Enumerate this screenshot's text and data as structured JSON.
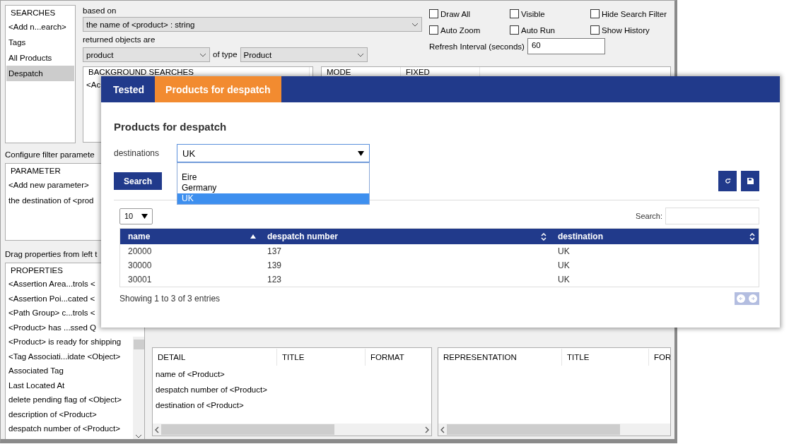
{
  "back_window": {
    "searches": {
      "header": "SEARCHES",
      "items": [
        {
          "label": "<Add n...earch>",
          "selected": false
        },
        {
          "label": "Tags",
          "selected": false
        },
        {
          "label": "All Products",
          "selected": false
        },
        {
          "label": "Despatch",
          "selected": true
        }
      ]
    },
    "based_on": {
      "label": "based on",
      "value": "the name of <product> : string"
    },
    "returned": {
      "label": "returned objects are",
      "value": "product",
      "type_label": "of type",
      "type_value": "Product"
    },
    "checkboxes": [
      {
        "label": "Draw All",
        "checked": false
      },
      {
        "label": "Visible",
        "checked": false
      },
      {
        "label": "Hide Search Filter",
        "checked": false
      },
      {
        "label": "Auto Zoom",
        "checked": false
      },
      {
        "label": "Auto Run",
        "checked": false
      },
      {
        "label": "Show History",
        "checked": false
      }
    ],
    "refresh": {
      "label": "Refresh Interval (seconds)",
      "value": "60"
    },
    "background_searches": {
      "header": "BACKGROUND SEARCHES",
      "items": [
        "<Ac"
      ]
    },
    "mode_panel": {
      "columns": [
        "MODE",
        "FIXED"
      ]
    },
    "parameters": {
      "caption": "Configure filter paramete",
      "header": "PARAMETER",
      "items": [
        "<Add new parameter>",
        "the destination of <prod"
      ]
    },
    "properties": {
      "caption": "Drag properties from left t",
      "header": "PROPERTIES",
      "items": [
        "<Assertion Area...trols <",
        "<Assertion Poi...cated <",
        "<Path Group> c...trols <",
        "<Product> has ...ssed Q",
        "<Product> is ready for shipping",
        "<Tag Associati...idate <Object>",
        "Associated Tag",
        "Last Located At",
        "delete pending flag of <Object>",
        "description of <Product>",
        "despatch number of <Product>"
      ]
    },
    "details": {
      "columns": [
        "DETAIL",
        "TITLE",
        "FORMAT"
      ],
      "rows": [
        "name of <Product>",
        "despatch number of <Product>",
        "destination of <Product>"
      ]
    },
    "representations": {
      "columns": [
        "REPRESENTATION",
        "TITLE",
        "FOR"
      ]
    }
  },
  "web_window": {
    "tabs": [
      {
        "label": "Tested",
        "selected": false
      },
      {
        "label": "Products for despatch",
        "selected": true
      }
    ],
    "heading": "Products for despatch",
    "filter": {
      "label": "destinations",
      "value": "UK",
      "options": [
        {
          "label": "Eire",
          "selected": false
        },
        {
          "label": "Germany",
          "selected": false
        },
        {
          "label": "UK",
          "selected": true
        }
      ]
    },
    "search_button": "Search",
    "page_length": "10",
    "search_label": "Search:",
    "table": {
      "columns": [
        {
          "label": "name",
          "sorted": true
        },
        {
          "label": "despatch number",
          "sorted": false
        },
        {
          "label": "destination",
          "sorted": false
        }
      ],
      "rows": [
        [
          "20000",
          "137",
          "UK"
        ],
        [
          "30000",
          "139",
          "UK"
        ],
        [
          "30001",
          "123",
          "UK"
        ]
      ]
    },
    "info": "Showing 1 to 3 of 3 entries"
  }
}
